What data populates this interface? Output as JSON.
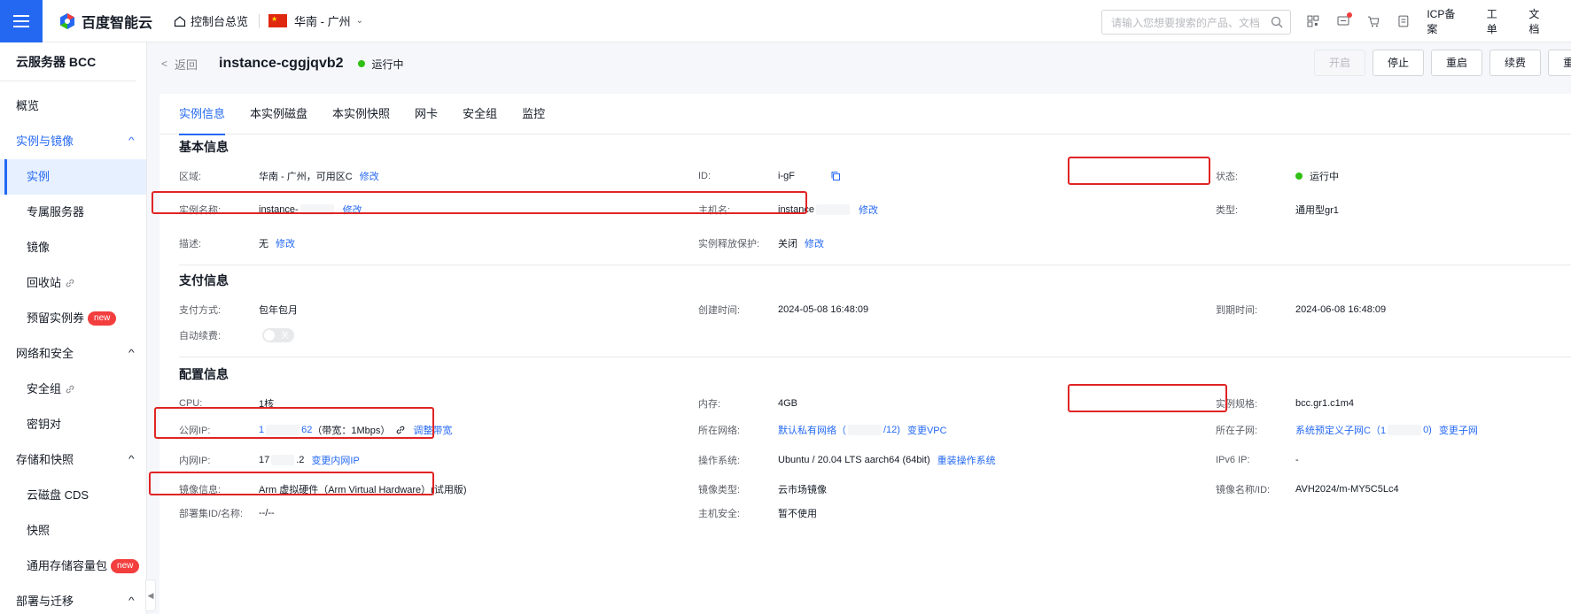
{
  "topbar": {
    "brand": "百度智能云",
    "home": "控制台总览",
    "region": "华南 - 广州",
    "search_placeholder": "请输入您想要搜索的产品、文档",
    "links": [
      "ICP备案",
      "工单",
      "文档"
    ]
  },
  "sidebar": {
    "title": "云服务器 BCC",
    "overview": "概览",
    "groups": [
      {
        "label": "实例与镜像",
        "items": [
          "实例",
          "专属服务器",
          "镜像",
          "回收站",
          "预留实例券"
        ]
      },
      {
        "label": "网络和安全",
        "items": [
          "安全组",
          "密钥对"
        ]
      },
      {
        "label": "存储和快照",
        "items": [
          "云磁盘 CDS",
          "快照",
          "通用存储容量包"
        ]
      },
      {
        "label": "部署与迁移",
        "items": []
      }
    ],
    "new_badge": "new"
  },
  "header": {
    "back": "返回",
    "instance_name": "instance-cggjqvb2",
    "status": "运行中",
    "buttons": [
      "开启",
      "停止",
      "重启",
      "续费",
      "重置密码"
    ]
  },
  "tabs": [
    "实例信息",
    "本实例磁盘",
    "本实例快照",
    "网卡",
    "安全组",
    "监控"
  ],
  "basic": {
    "title": "基本信息",
    "region_label": "区域:",
    "region_value": "华南 - 广州，可用区C",
    "id_label": "ID:",
    "id_value": "i-gF",
    "state_label": "状态:",
    "state_value": "运行中",
    "name_label": "实例名称:",
    "name_value": "instance-",
    "host_label": "主机名:",
    "host_value": "instance",
    "type_label": "类型:",
    "type_value": "通用型gr1",
    "desc_label": "描述:",
    "desc_value": "无",
    "release_label": "实例释放保护:",
    "release_value": "关闭",
    "edit": "修改"
  },
  "payment": {
    "title": "支付信息",
    "method_label": "支付方式:",
    "method_value": "包年包月",
    "created_label": "创建时间:",
    "created_value": "2024-05-08 16:48:09",
    "expire_label": "到期时间:",
    "expire_value": "2024-06-08 16:48:09",
    "autorenew_label": "自动续费:",
    "autorenew_value": "关"
  },
  "config": {
    "title": "配置信息",
    "cpu_label": "CPU:",
    "cpu_value": "1核",
    "mem_label": "内存:",
    "mem_value": "4GB",
    "spec_label": "实例规格:",
    "spec_value": "bcc.gr1.c1m4",
    "pubip_label": "公网IP:",
    "pubip_prefix": "1",
    "pubip_suffix": "62",
    "bandwidth": "（带宽：1Mbps）",
    "adjust_bw": "调整带宽",
    "net_label": "所在网络:",
    "net_value_a": "默认私有网络（",
    "net_value_b": "/12)",
    "change_vpc": "变更VPC",
    "subnet_label": "所在子网:",
    "subnet_value_a": "系统预定义子网C（1",
    "subnet_value_b": "0)",
    "change_subnet": "变更子网",
    "priv_label": "内网IP:",
    "priv_prefix": "17",
    "priv_suffix": ".2",
    "change_priv": "变更内网IP",
    "os_label": "操作系统:",
    "os_value": "Ubuntu / 20.04 LTS aarch64 (64bit)",
    "reinstall": "重装操作系统",
    "ipv6_label": "IPv6 IP:",
    "ipv6_value": "-",
    "image_label": "镜像信息:",
    "image_value": "Arm 虚拟硬件（Arm Virtual Hardware）(试用版)",
    "imgtype_label": "镜像类型:",
    "imgtype_value": "云市场镜像",
    "imgname_label": "镜像名称/ID:",
    "imgname_value": "AVH2024/m-MY5C5Lc4",
    "deploy_label": "部署集ID/名称:",
    "deploy_value": "--/--",
    "hostsec_label": "主机安全:",
    "hostsec_value": "暂不使用"
  },
  "colors": {
    "accent": "#2468f2",
    "running": "#30bf13",
    "highlight": "#e02424",
    "new_badge": "#f33e3e"
  }
}
